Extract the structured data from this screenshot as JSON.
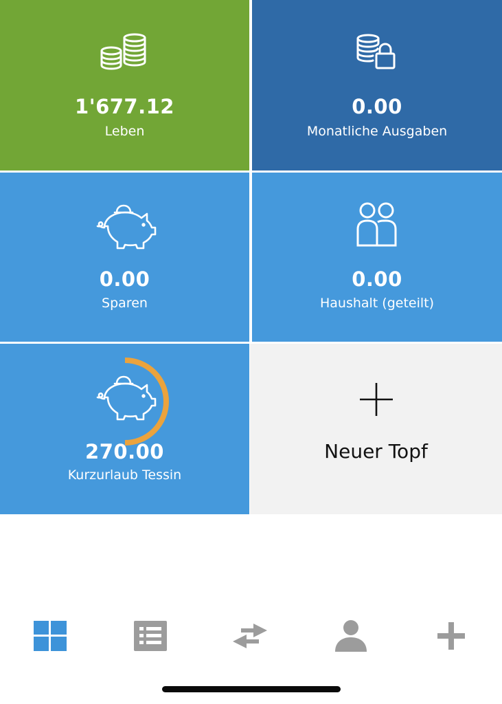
{
  "colors": {
    "green": "#72a636",
    "dark_blue": "#2f6aa7",
    "blue": "#4599dc",
    "light_gray": "#f2f2f2",
    "ring_orange": "#eba33d",
    "tab_active": "#3d93d9",
    "tab_inactive": "#9c9c9c"
  },
  "tiles": [
    {
      "amount": "1'677.12",
      "label": "Leben",
      "icon": "coins-icon"
    },
    {
      "amount": "0.00",
      "label": "Monatliche Ausgaben",
      "icon": "coins-lock-icon"
    },
    {
      "amount": "0.00",
      "label": "Sparen",
      "icon": "piggy-bank-icon"
    },
    {
      "amount": "0.00",
      "label": "Haushalt (geteilt)",
      "icon": "people-icon"
    },
    {
      "amount": "270.00",
      "label": "Kurzurlaub Tessin",
      "icon": "piggy-bank-icon",
      "progress": 0.5
    }
  ],
  "new_pot": {
    "label": "Neuer Topf",
    "icon": "plus-icon"
  },
  "tabbar": [
    {
      "icon": "grid-icon",
      "active": true
    },
    {
      "icon": "list-icon",
      "active": false
    },
    {
      "icon": "transfer-arrows-icon",
      "active": false
    },
    {
      "icon": "person-icon",
      "active": false
    },
    {
      "icon": "plus-icon",
      "active": false
    }
  ]
}
